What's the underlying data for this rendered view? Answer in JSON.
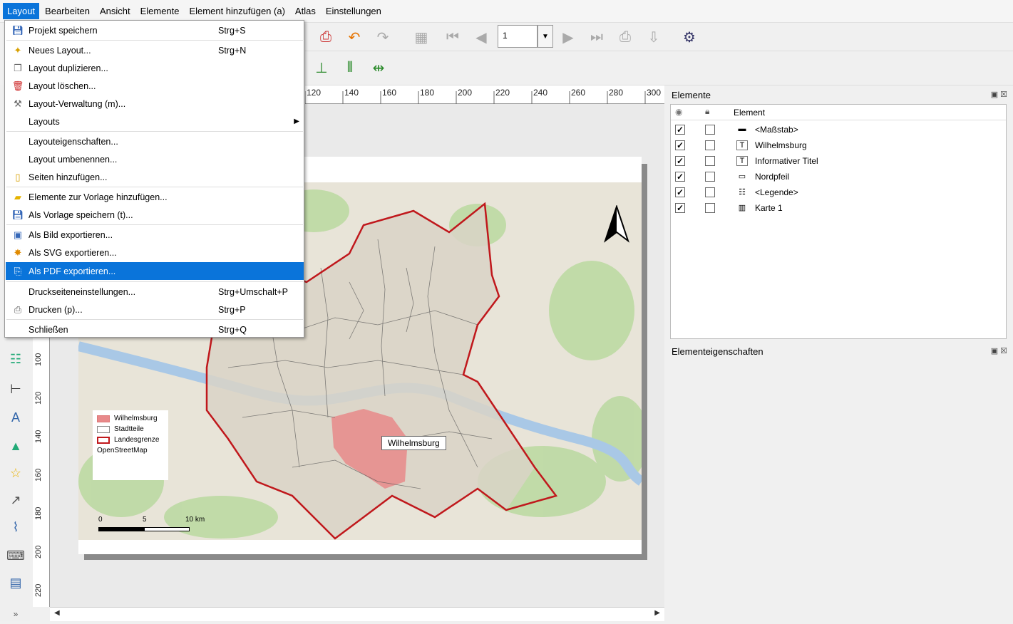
{
  "menubar": {
    "items": [
      "Layout",
      "Bearbeiten",
      "Ansicht",
      "Elemente",
      "Element hinzufügen (a)",
      "Atlas",
      "Einstellungen"
    ]
  },
  "layout_menu": {
    "items": [
      {
        "label": "Projekt speichern",
        "shortcut": "Strg+S",
        "icon": "save-icon"
      },
      {
        "label": "Neues Layout...",
        "shortcut": "Strg+N",
        "icon": "new-layout-icon"
      },
      {
        "label": "Layout duplizieren...",
        "shortcut": "",
        "icon": "duplicate-layout-icon"
      },
      {
        "label": "Layout löschen...",
        "shortcut": "",
        "icon": "delete-icon"
      },
      {
        "label": "Layout-Verwaltung (m)...",
        "shortcut": "",
        "icon": "layout-manager-icon"
      },
      {
        "label": "Layouts",
        "shortcut": "",
        "icon": "",
        "submenu": true
      },
      {
        "label": "Layouteigenschaften...",
        "shortcut": "",
        "icon": ""
      },
      {
        "label": "Layout umbenennen...",
        "shortcut": "",
        "icon": ""
      },
      {
        "label": "Seiten hinzufügen...",
        "shortcut": "",
        "icon": "add-page-icon"
      },
      {
        "label": "Elemente zur Vorlage hinzufügen...",
        "shortcut": "",
        "icon": "folder-icon"
      },
      {
        "label": "Als Vorlage speichern (t)...",
        "shortcut": "",
        "icon": "save-template-icon"
      },
      {
        "label": "Als Bild exportieren...",
        "shortcut": "",
        "icon": "export-image-icon"
      },
      {
        "label": "Als SVG exportieren...",
        "shortcut": "",
        "icon": "export-svg-icon"
      },
      {
        "label": "Als PDF exportieren...",
        "shortcut": "",
        "icon": "export-pdf-icon",
        "selected": true
      },
      {
        "label": "Druckseiteneinstellungen...",
        "shortcut": "Strg+Umschalt+P",
        "icon": ""
      },
      {
        "label": "Drucken (p)...",
        "shortcut": "Strg+P",
        "icon": "print-icon"
      },
      {
        "label": "Schließen",
        "shortcut": "Strg+Q",
        "icon": ""
      }
    ]
  },
  "toolbar": {
    "page_number": "1"
  },
  "ruler": {
    "h_labels": [
      "120",
      "140",
      "160",
      "180",
      "200",
      "220",
      "240",
      "260",
      "280",
      "300"
    ],
    "v_labels": [
      "100",
      "120",
      "140",
      "160",
      "180",
      "200",
      "220"
    ]
  },
  "map": {
    "highlight_label": "Wilhelmsburg",
    "legend": [
      {
        "label": "Wilhelmsburg",
        "swatch": "#e8898a"
      },
      {
        "label": "Stadtteile",
        "swatch": "#ffffff"
      },
      {
        "label": "Landesgrenze",
        "swatch": "#ffffff"
      },
      {
        "label": "OpenStreetMap",
        "swatch": ""
      }
    ],
    "scale_labels": [
      "0",
      "5",
      "10 km"
    ]
  },
  "elements_panel": {
    "title": "Elemente",
    "column_header": "Element",
    "rows": [
      {
        "name": "<Maßstab>",
        "visible": true,
        "locked": false,
        "icon": "scalebar-icon"
      },
      {
        "name": "Wilhelmsburg",
        "visible": true,
        "locked": false,
        "icon": "text-icon"
      },
      {
        "name": "Informativer Titel",
        "visible": true,
        "locked": false,
        "icon": "text-icon"
      },
      {
        "name": "Nordpfeil",
        "visible": true,
        "locked": false,
        "icon": "picture-icon"
      },
      {
        "name": "<Legende>",
        "visible": true,
        "locked": false,
        "icon": "legend-icon"
      },
      {
        "name": "Karte 1",
        "visible": true,
        "locked": false,
        "icon": "map-icon"
      }
    ]
  },
  "props_panel": {
    "title": "Elementeigenschaften"
  },
  "colors": {
    "accent": "#0a74da",
    "boundary": "#c0181c",
    "highlight": "#e8898a"
  }
}
